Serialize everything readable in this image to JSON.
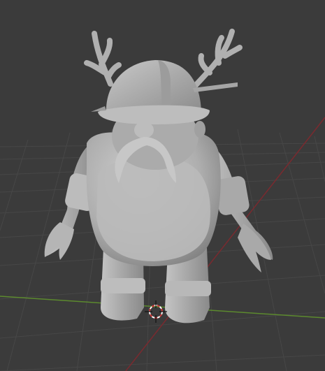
{
  "viewport": {
    "background_color": "#3b3b3b",
    "grid_color": "#474747",
    "x_axis_color": "#7a2a2f",
    "y_axis_color": "#5c8a2e",
    "model_color": "#b3b3b3",
    "model_shadow_color": "#8a8a8a",
    "cursor_colors": [
      "#d33a3a",
      "#ffffff"
    ],
    "icons": [
      "3d-cursor-icon"
    ]
  }
}
